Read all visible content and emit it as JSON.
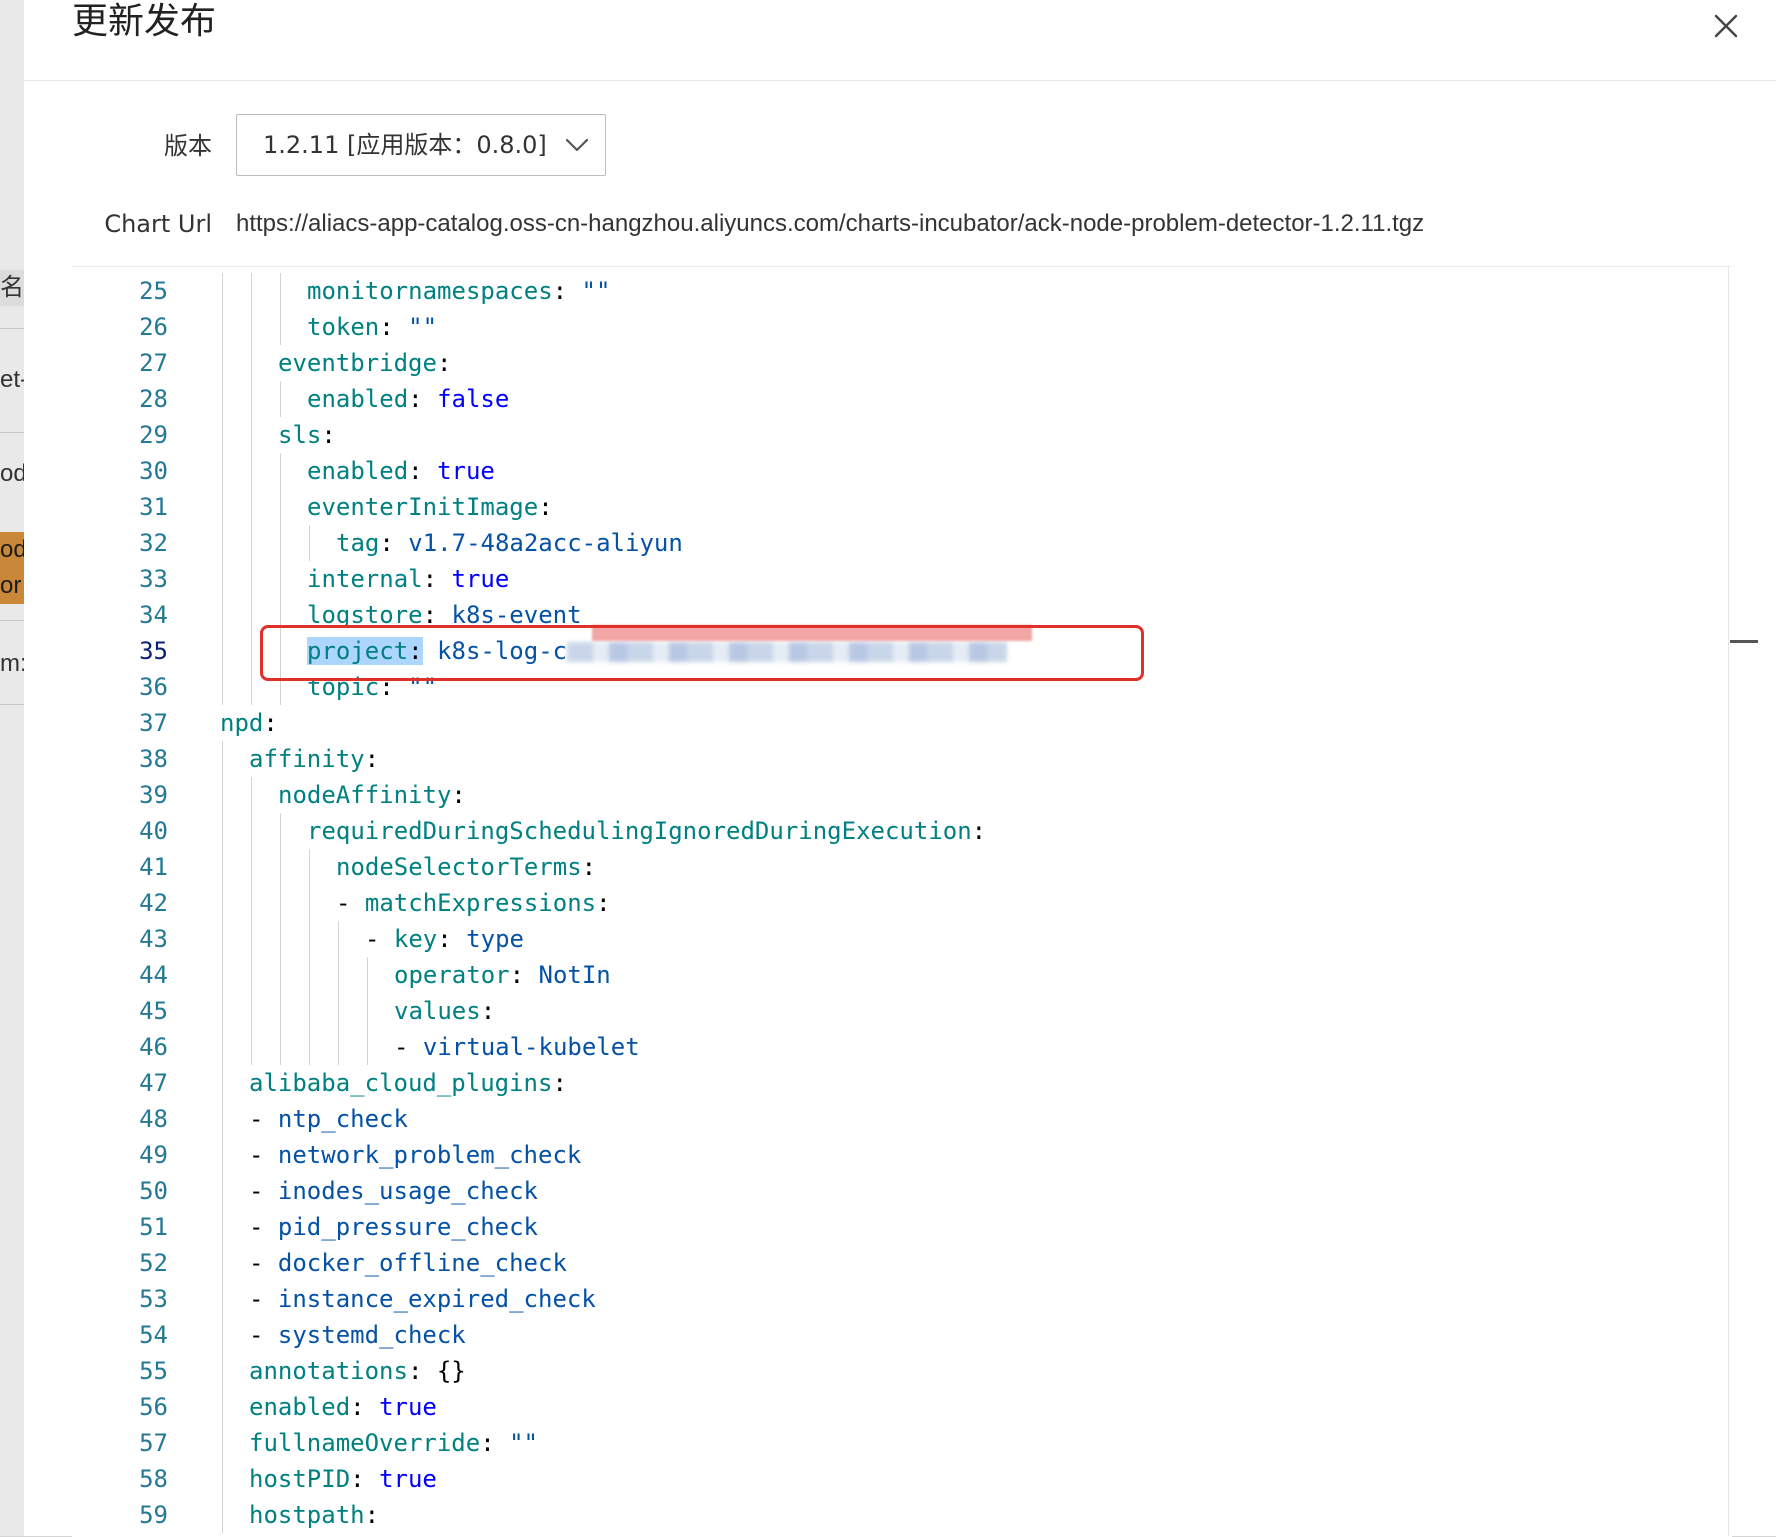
{
  "background": {
    "fragments": [
      "名称",
      "et-",
      "od",
      "od",
      "or",
      "m:"
    ]
  },
  "dialog": {
    "title": "更新发布",
    "close_icon": "close-icon"
  },
  "form": {
    "version_label": "版本",
    "version_value": "1.2.11 [应用版本：0.8.0]",
    "chart_url_label": "Chart Url",
    "chart_url_value": "https://aliacs-app-catalog.oss-cn-hangzhou.aliyuncs.com/charts-incubator/ack-node-problem-detector-1.2.11.tgz"
  },
  "editor": {
    "active_line": 35,
    "lines": [
      {
        "n": "25",
        "key": "monitornamespaces",
        "val": "\"\"",
        "indent": 3,
        "vt": "s"
      },
      {
        "n": "26",
        "key": "token",
        "val": "\"\"",
        "indent": 3,
        "vt": "s"
      },
      {
        "n": "27",
        "key": "eventbridge",
        "val": "",
        "indent": 2,
        "vt": "s"
      },
      {
        "n": "28",
        "key": "enabled",
        "val": "false",
        "indent": 3,
        "vt": "b"
      },
      {
        "n": "29",
        "key": "sls",
        "val": "",
        "indent": 2,
        "vt": "s"
      },
      {
        "n": "30",
        "key": "enabled",
        "val": "true",
        "indent": 3,
        "vt": "b"
      },
      {
        "n": "31",
        "key": "eventerInitImage",
        "val": "",
        "indent": 3,
        "vt": "s"
      },
      {
        "n": "32",
        "key": "tag",
        "val": "v1.7-48a2acc-aliyun",
        "indent": 4,
        "vt": "s"
      },
      {
        "n": "33",
        "key": "internal",
        "val": "true",
        "indent": 3,
        "vt": "b"
      },
      {
        "n": "34",
        "key": "logstore",
        "val": "k8s-event",
        "indent": 3,
        "vt": "s"
      },
      {
        "n": "35",
        "key": "project",
        "val": "k8s-log-c",
        "indent": 3,
        "vt": "s",
        "selected": true,
        "redacted": true
      },
      {
        "n": "36",
        "key": "topic",
        "val": "\"\"",
        "indent": 3,
        "vt": "s"
      },
      {
        "n": "37",
        "key": "npd",
        "val": "",
        "indent": 0,
        "vt": "s"
      },
      {
        "n": "38",
        "key": "affinity",
        "val": "",
        "indent": 1,
        "vt": "s"
      },
      {
        "n": "39",
        "key": "nodeAffinity",
        "val": "",
        "indent": 2,
        "vt": "s"
      },
      {
        "n": "40",
        "key": "requiredDuringSchedulingIgnoredDuringExecution",
        "val": "",
        "indent": 3,
        "vt": "s"
      },
      {
        "n": "41",
        "key": "nodeSelectorTerms",
        "val": "",
        "indent": 4,
        "vt": "s"
      },
      {
        "n": "42",
        "key": "matchExpressions",
        "val": "",
        "indent": 4,
        "vt": "s",
        "dash": true
      },
      {
        "n": "43",
        "key": "key",
        "val": "type",
        "indent": 5,
        "vt": "s",
        "dash": true
      },
      {
        "n": "44",
        "key": "operator",
        "val": "NotIn",
        "indent": 6,
        "vt": "s"
      },
      {
        "n": "45",
        "key": "values",
        "val": "",
        "indent": 6,
        "vt": "s"
      },
      {
        "n": "46",
        "key": "",
        "val": "virtual-kubelet",
        "indent": 6,
        "vt": "s",
        "dash": true
      },
      {
        "n": "47",
        "key": "alibaba_cloud_plugins",
        "val": "",
        "indent": 1,
        "vt": "s"
      },
      {
        "n": "48",
        "key": "",
        "val": "ntp_check",
        "indent": 1,
        "vt": "s",
        "dash": true
      },
      {
        "n": "49",
        "key": "",
        "val": "network_problem_check",
        "indent": 1,
        "vt": "s",
        "dash": true
      },
      {
        "n": "50",
        "key": "",
        "val": "inodes_usage_check",
        "indent": 1,
        "vt": "s",
        "dash": true
      },
      {
        "n": "51",
        "key": "",
        "val": "pid_pressure_check",
        "indent": 1,
        "vt": "s",
        "dash": true
      },
      {
        "n": "52",
        "key": "",
        "val": "docker_offline_check",
        "indent": 1,
        "vt": "s",
        "dash": true
      },
      {
        "n": "53",
        "key": "",
        "val": "instance_expired_check",
        "indent": 1,
        "vt": "s",
        "dash": true
      },
      {
        "n": "54",
        "key": "",
        "val": "systemd_check",
        "indent": 1,
        "vt": "s",
        "dash": true
      },
      {
        "n": "55",
        "key": "annotations",
        "val": "{}",
        "indent": 1,
        "vt": "p"
      },
      {
        "n": "56",
        "key": "enabled",
        "val": "true",
        "indent": 1,
        "vt": "b"
      },
      {
        "n": "57",
        "key": "fullnameOverride",
        "val": "\"\"",
        "indent": 1,
        "vt": "s"
      },
      {
        "n": "58",
        "key": "hostPID",
        "val": "true",
        "indent": 1,
        "vt": "b"
      },
      {
        "n": "59",
        "key": "hostpath",
        "val": "",
        "indent": 1,
        "vt": "s"
      }
    ]
  },
  "colors": {
    "line_number": "#237893",
    "key": "#008080",
    "boolean": "#0000ff",
    "string": "#0451a5",
    "selection": "#add6ff",
    "annotation_box": "#e0302a"
  }
}
